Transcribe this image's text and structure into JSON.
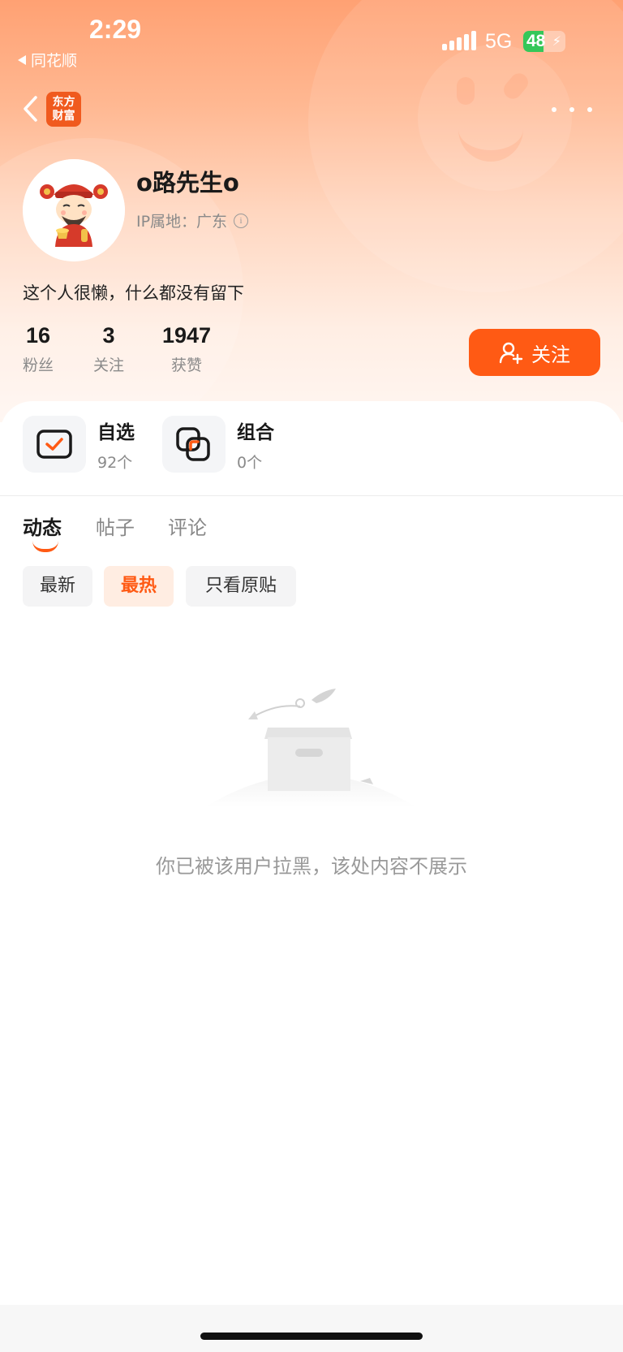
{
  "status_bar": {
    "time": "2:29",
    "back_app": "同花顺",
    "network": "5G",
    "battery_percent": 48,
    "battery_label": "48"
  },
  "nav": {
    "brand_line1": "东方",
    "brand_line2": "财富"
  },
  "profile": {
    "username": "o路先生o",
    "ip_location": "IP属地：广东",
    "bio": "这个人很懒，什么都没有留下",
    "stats": [
      {
        "value": "16",
        "label": "粉丝"
      },
      {
        "value": "3",
        "label": "关注"
      },
      {
        "value": "1947",
        "label": "获赞"
      }
    ],
    "follow_label": "关注"
  },
  "portfolio": {
    "watchlist": {
      "title": "自选",
      "count": "92个"
    },
    "combo": {
      "title": "组合",
      "count": "0个"
    }
  },
  "tabs": [
    {
      "label": "动态",
      "active": true
    },
    {
      "label": "帖子",
      "active": false
    },
    {
      "label": "评论",
      "active": false
    }
  ],
  "filters": [
    {
      "label": "最新",
      "active": false
    },
    {
      "label": "最热",
      "active": true
    },
    {
      "label": "只看原贴",
      "active": false
    }
  ],
  "empty_state": {
    "message": "你已被该用户拉黑，该处内容不展示"
  },
  "colors": {
    "accent": "#ff5a14",
    "battery_green": "#34c759"
  }
}
